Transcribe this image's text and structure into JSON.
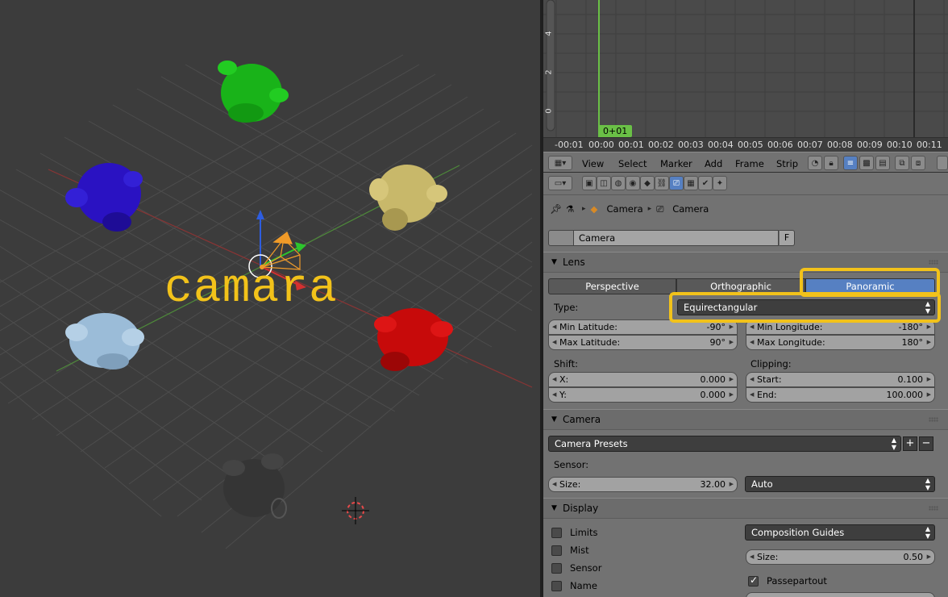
{
  "viewport": {
    "overlay_text": "camara"
  },
  "timeline": {
    "y_labels": [
      "4",
      "2",
      "0"
    ],
    "current_frame": "0+01",
    "ruler_labels": [
      "-00:01",
      "00:00",
      "00:01",
      "00:02",
      "00:03",
      "00:04",
      "00:05",
      "00:06",
      "00:07",
      "00:08",
      "00:09",
      "00:10",
      "00:11"
    ],
    "menu": [
      "View",
      "Select",
      "Marker",
      "Add",
      "Frame",
      "Strip"
    ]
  },
  "properties": {
    "breadcrumb": [
      "Camera",
      "Camera"
    ],
    "datablock_name": "Camera",
    "datablock_fake": "F",
    "lens_panel": {
      "title": "Lens",
      "projection_modes": [
        "Perspective",
        "Orthographic",
        "Panoramic"
      ],
      "active_mode": "Panoramic",
      "type_label": "Type:",
      "type_value": "Equirectangular",
      "min_latitude": {
        "label": "Min Latitude:",
        "value": "-90°"
      },
      "max_latitude": {
        "label": "Max Latitude:",
        "value": "90°"
      },
      "min_longitude": {
        "label": "Min Longitude:",
        "value": "-180°"
      },
      "max_longitude": {
        "label": "Max Longitude:",
        "value": "180°"
      },
      "shift_label": "Shift:",
      "shift_x": {
        "label": "X:",
        "value": "0.000"
      },
      "shift_y": {
        "label": "Y:",
        "value": "0.000"
      },
      "clipping_label": "Clipping:",
      "clip_start": {
        "label": "Start:",
        "value": "0.100"
      },
      "clip_end": {
        "label": "End:",
        "value": "100.000"
      }
    },
    "camera_panel": {
      "title": "Camera",
      "presets": "Camera Presets",
      "sensor_label": "Sensor:",
      "size": {
        "label": "Size:",
        "value": "32.00"
      },
      "fit": "Auto"
    },
    "display_panel": {
      "title": "Display",
      "checks": [
        "Limits",
        "Mist",
        "Sensor",
        "Name"
      ],
      "guides": "Composition Guides",
      "size": {
        "label": "Size:",
        "value": "0.50"
      },
      "passepartout": "Passepartout"
    }
  },
  "colors": {
    "highlight": "#f2c21a",
    "active_button": "#5680c2",
    "frame_marker": "#6ac046"
  }
}
